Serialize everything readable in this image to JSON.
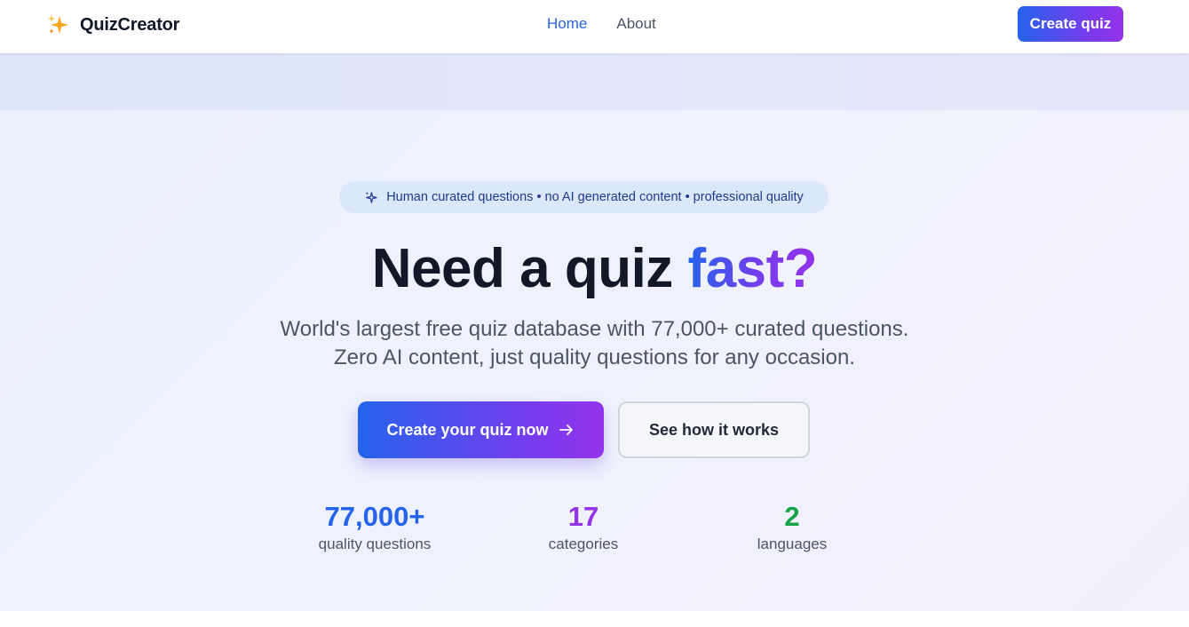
{
  "navbar": {
    "brand_icon": "sparkles-icon",
    "brand_name": "QuizCreator",
    "links": [
      {
        "label": "Home",
        "active": true
      },
      {
        "label": "About",
        "active": false
      }
    ],
    "cta_label": "Create quiz"
  },
  "hero": {
    "pill_icon": "sparkles-icon",
    "pill_text": "Human curated questions • no AI generated content • professional quality",
    "headline_plain": "Need a quiz ",
    "headline_accent": "fast?",
    "subtitle_line1": "World's largest free quiz database with 77,000+ curated questions.",
    "subtitle_line2": "Zero AI content, just quality questions for any occasion.",
    "primary_button": "Create your quiz now",
    "primary_button_icon": "arrow-right-icon",
    "secondary_button": "See how it works",
    "stats": [
      {
        "value": "77,000+",
        "label": "quality questions",
        "color": "#2563eb"
      },
      {
        "value": "17",
        "label": "categories",
        "color": "#9333ea"
      },
      {
        "value": "2",
        "label": "languages",
        "color": "#16a34a"
      }
    ]
  },
  "colors": {
    "accent_blue": "#2563eb",
    "accent_purple": "#9333ea",
    "accent_green": "#16a34a",
    "text_dark": "#111827",
    "text_muted": "#4b5563"
  }
}
